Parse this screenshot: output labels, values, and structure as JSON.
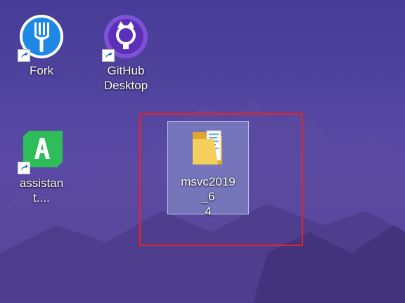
{
  "desktop": {
    "icons": [
      {
        "label": "Fork",
        "icon": "fork-icon",
        "color": "#1e88e5"
      },
      {
        "label": "GitHub\nDesktop",
        "icon": "github-desktop-icon",
        "color": "#6e40c9"
      },
      {
        "label": "assistant....",
        "icon": "qt-assistant-icon",
        "color": "#2ebd59"
      },
      {
        "label": "msvc2019_6\n4",
        "icon": "folder-icon",
        "color": "#f0c64a"
      }
    ],
    "highlight_color": "#e5242b"
  }
}
